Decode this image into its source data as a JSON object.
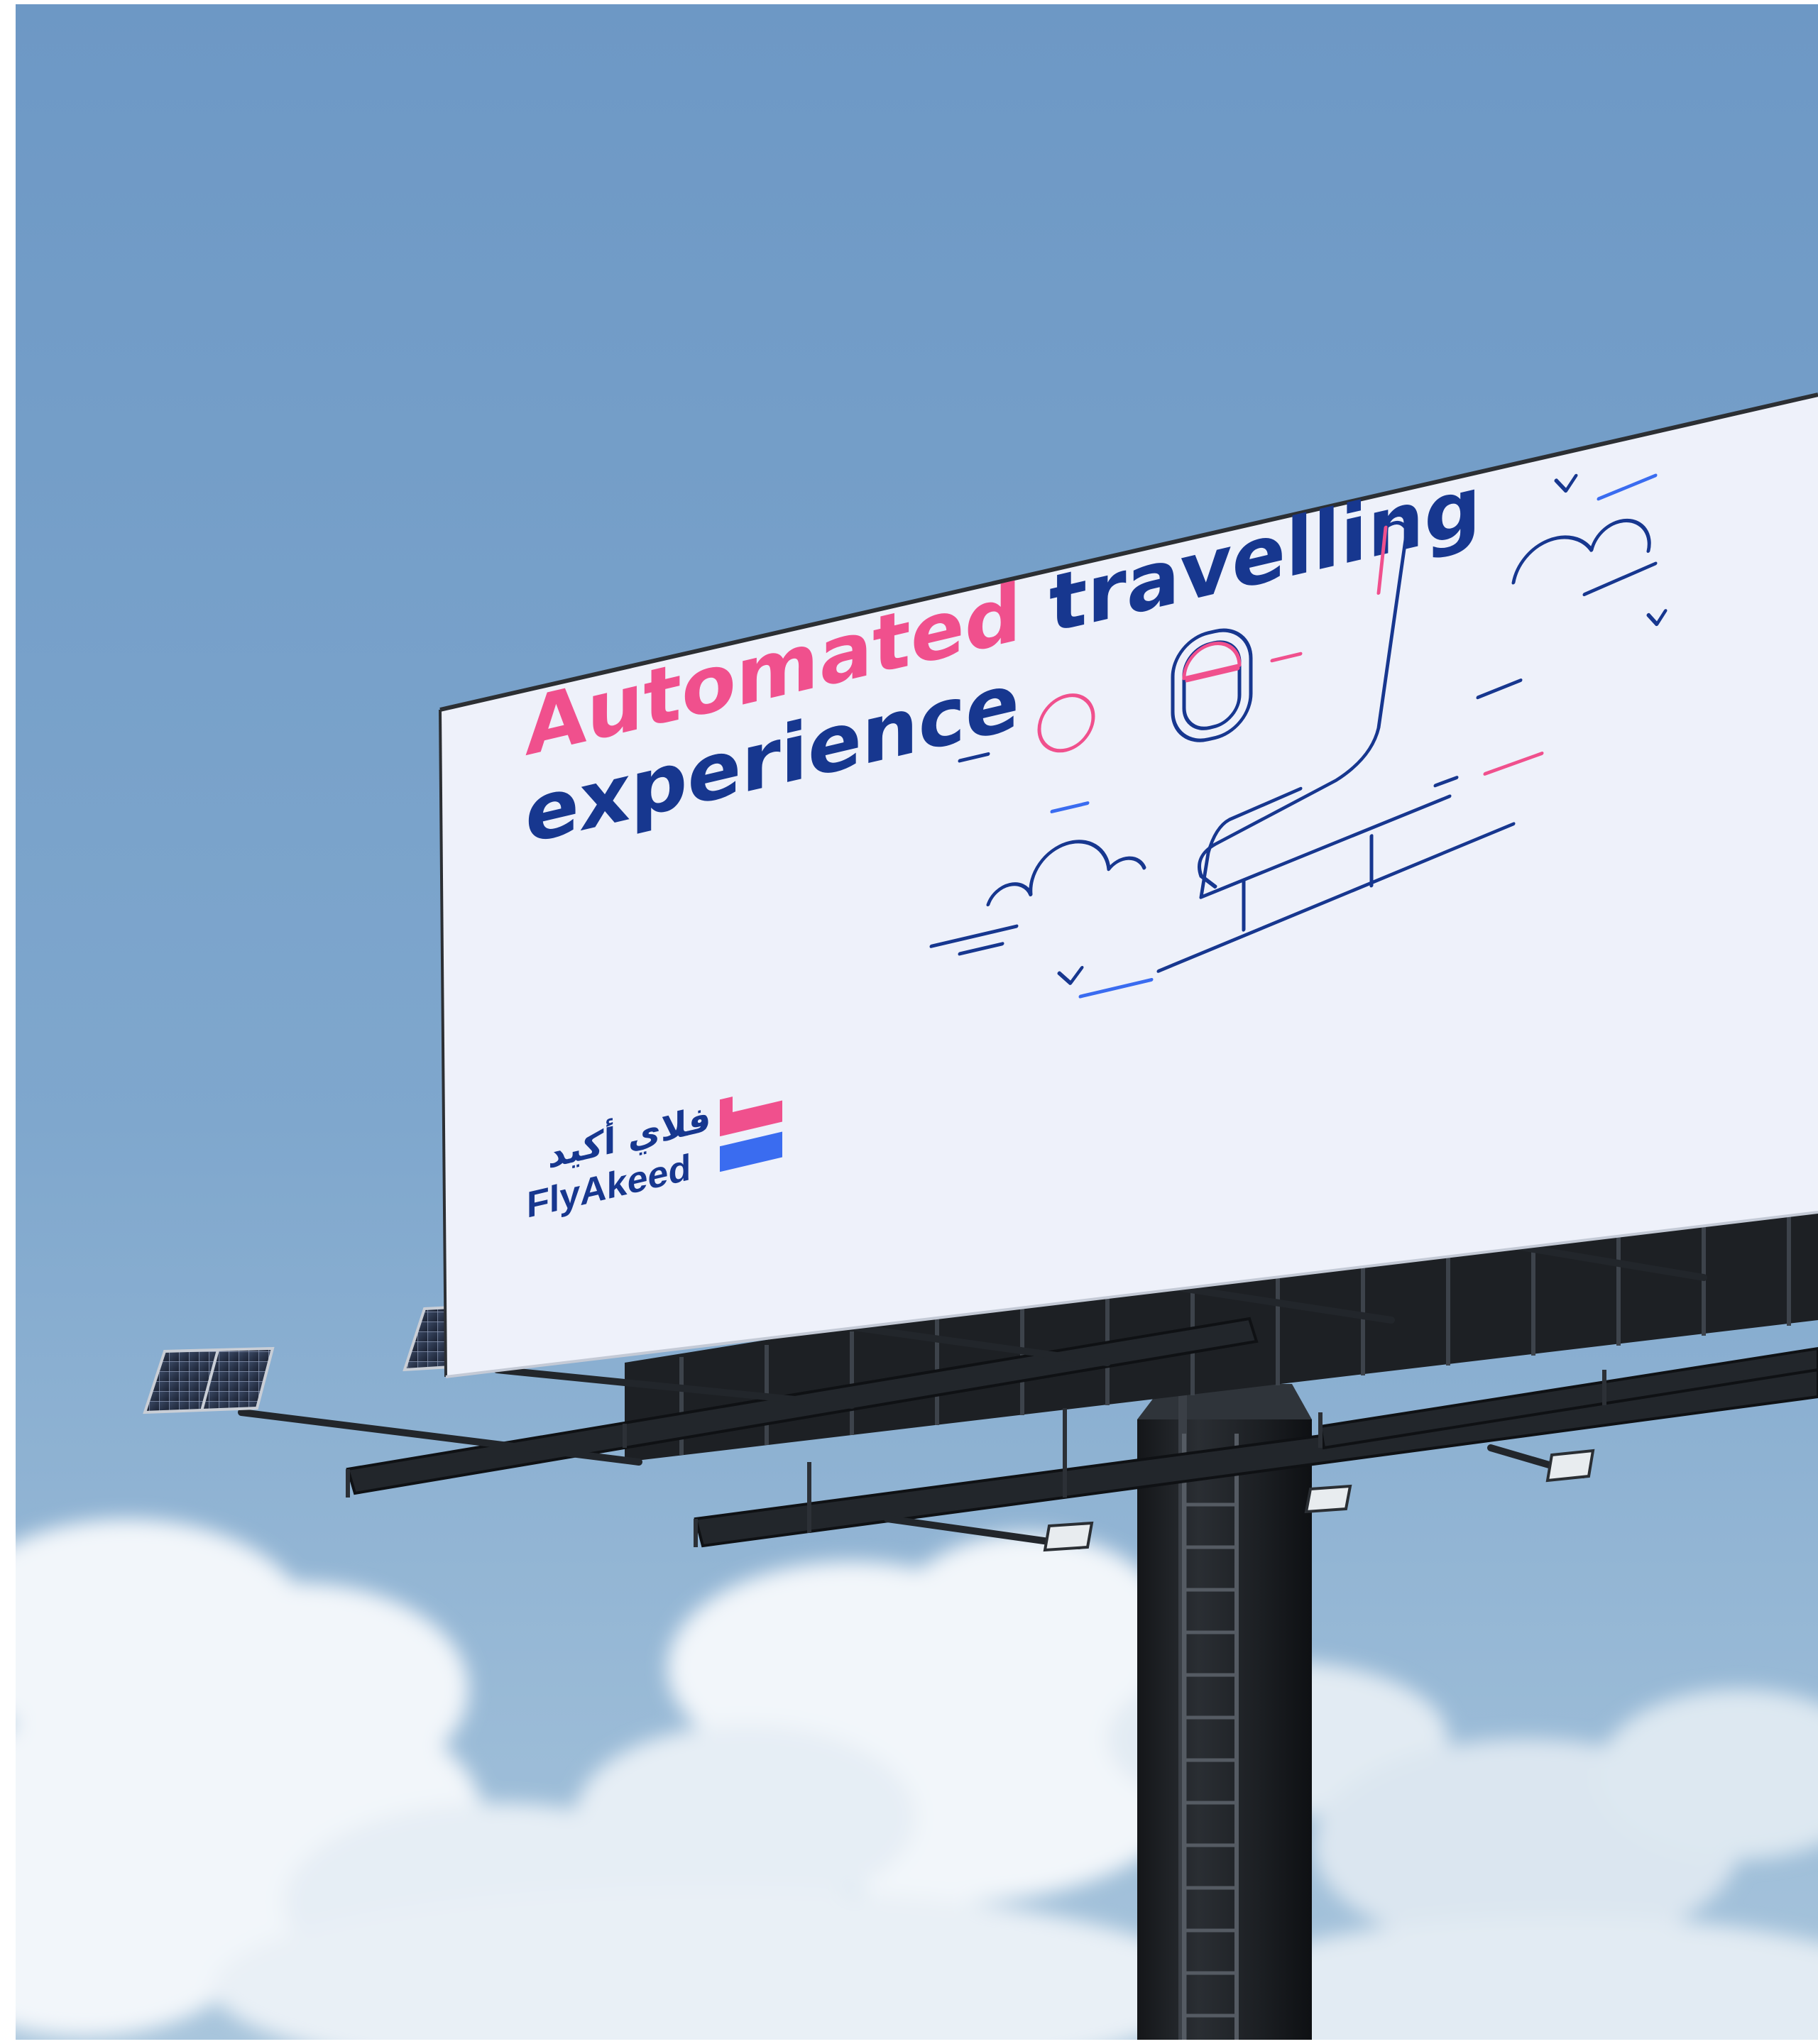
{
  "billboard": {
    "headline_accent": "Automated",
    "headline_rest": "travelling",
    "headline_line2": "experience"
  },
  "brand": {
    "name_arabic": "فلاي أكيد",
    "name_latin": "FlyAkeed",
    "logo_icon": "flyakeed-flag-logo-icon"
  },
  "colors": {
    "brand_pink": "#f0508d",
    "brand_navy": "#17378f",
    "brand_blue": "#3a6cf0",
    "billboard_face": "#eef1fa",
    "sky_top": "#6f9ac6",
    "sky_bottom": "#a9c6dd"
  },
  "scene": {
    "illustration_icons": [
      "airplane-seat-icon",
      "airplane-window-icon",
      "sun-icon",
      "cloud-icon",
      "bird-icon"
    ],
    "structure": [
      "billboard-pole",
      "maintenance-ladder",
      "catwalk-platform",
      "solar-panel",
      "floodlight"
    ]
  }
}
